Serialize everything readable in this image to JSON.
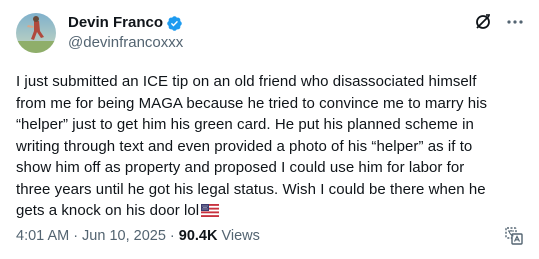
{
  "author": {
    "display_name": "Devin Franco",
    "handle": "@devinfrancoxxx"
  },
  "icons": {
    "avatar": "avatar",
    "verified": "verified-badge-icon",
    "grok": "grok-icon",
    "more": "more-icon",
    "flag": "us-flag-icon",
    "translate": "translate-icon"
  },
  "tweet": {
    "text": "I just submitted an ICE tip on an old friend who disassociated himself\nfrom me for being MAGA because he tried to convince me to marry his\n“helper” just to get him his green card. He put his planned scheme in\nwriting through text and even provided a photo of his “helper” as if to\nshow him off as property and proposed I could use him for labor for\nthree years until he got his legal status. Wish I could be there when he\ngets a knock on his door lol"
  },
  "meta": {
    "time": "4:01 AM",
    "separator": "·",
    "date": "Jun 10, 2025",
    "views_count": "90.4K",
    "views_label": "Views"
  },
  "colors": {
    "text": "#0f1419",
    "secondary": "#536471",
    "verified": "#1d9bf0",
    "background": "#ffffff"
  }
}
